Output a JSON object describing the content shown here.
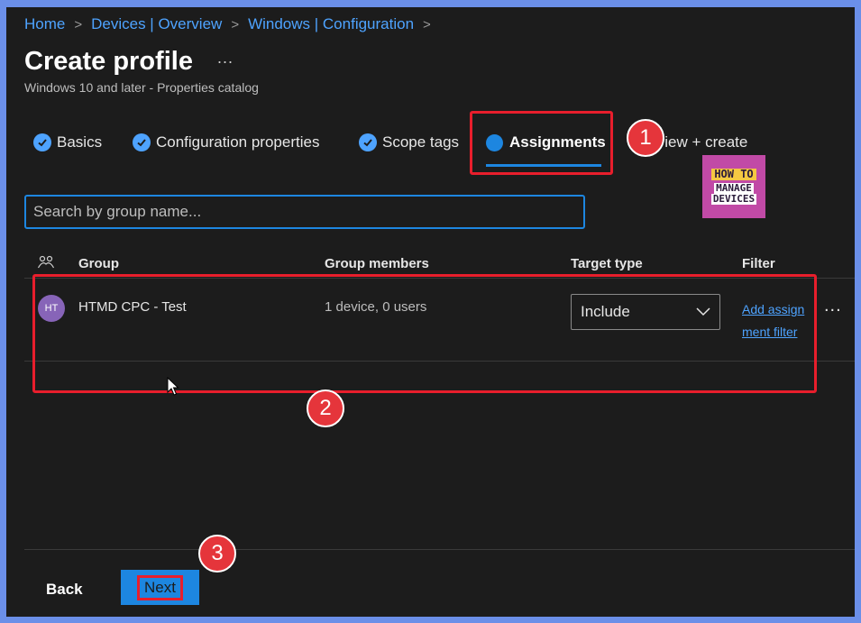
{
  "breadcrumb": {
    "items": [
      "Home",
      "Devices | Overview",
      "Windows | Configuration"
    ],
    "separator": ">"
  },
  "page": {
    "title": "Create profile",
    "more": "...",
    "subtitle": "Windows 10 and later - Properties catalog"
  },
  "steps": [
    {
      "label": "Basics",
      "state": "complete"
    },
    {
      "label": "Configuration properties",
      "state": "complete"
    },
    {
      "label": "Scope tags",
      "state": "complete"
    },
    {
      "label": "Assignments",
      "state": "active"
    },
    {
      "label": "Review + create",
      "state": "pending"
    }
  ],
  "annotations": {
    "badge1": "1",
    "badge2": "2",
    "badge3": "3"
  },
  "logo": {
    "line1": "HOW TO",
    "line2a": "MANAGE",
    "line2b": "DEVICES"
  },
  "search": {
    "placeholder": "Search by group name..."
  },
  "table": {
    "headers": {
      "group": "Group",
      "members": "Group members",
      "target": "Target type",
      "filter": "Filter"
    },
    "rows": [
      {
        "avatar": "HT",
        "group": "HTMD CPC - Test",
        "members": "1 device, 0 users",
        "target_type": "Include",
        "filter_link": "Add assignment filter",
        "more": "..."
      }
    ]
  },
  "footer": {
    "back_label": "Back",
    "next_label": "Next"
  },
  "colors": {
    "accent": "#1d86e0",
    "highlight": "#e81e2c",
    "link": "#4ea3ff",
    "background": "#1c1c1c",
    "border": "#6b8fe8"
  }
}
